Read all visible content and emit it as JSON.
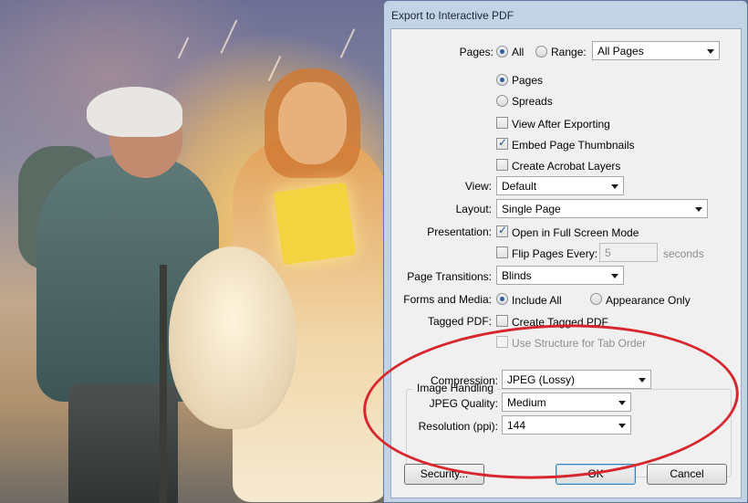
{
  "window": {
    "title": "Export to Interactive PDF"
  },
  "pages": {
    "label": "Pages:",
    "all_label": "All",
    "range_label": "Range:",
    "range_value": "All Pages",
    "option_pages": "Pages",
    "option_spreads": "Spreads"
  },
  "options": {
    "view_after_exporting": "View After Exporting",
    "embed_thumbnails": "Embed Page Thumbnails",
    "create_layers": "Create Acrobat Layers"
  },
  "view": {
    "label": "View:",
    "value": "Default"
  },
  "layout": {
    "label": "Layout:",
    "value": "Single Page"
  },
  "presentation": {
    "label": "Presentation:",
    "full_screen": "Open in Full Screen Mode",
    "flip_pages": "Flip Pages Every:",
    "flip_value": "5",
    "seconds": "seconds"
  },
  "transitions": {
    "label": "Page Transitions:",
    "value": "Blinds"
  },
  "forms": {
    "label": "Forms and Media:",
    "include_all": "Include All",
    "appearance_only": "Appearance Only"
  },
  "tagged": {
    "label": "Tagged PDF:",
    "create_tagged": "Create Tagged PDF",
    "use_structure": "Use Structure for Tab Order"
  },
  "image_handling": {
    "title": "Image Handling",
    "compression_label": "Compression:",
    "compression_value": "JPEG (Lossy)",
    "quality_label": "JPEG Quality:",
    "quality_value": "Medium",
    "resolution_label": "Resolution (ppi):",
    "resolution_value": "144"
  },
  "buttons": {
    "security": "Security...",
    "ok": "OK",
    "cancel": "Cancel"
  },
  "colors": {
    "annotation": "#d7262d",
    "title_bar": "#c3d3e6",
    "radio_dot": "#2d5fa8"
  }
}
